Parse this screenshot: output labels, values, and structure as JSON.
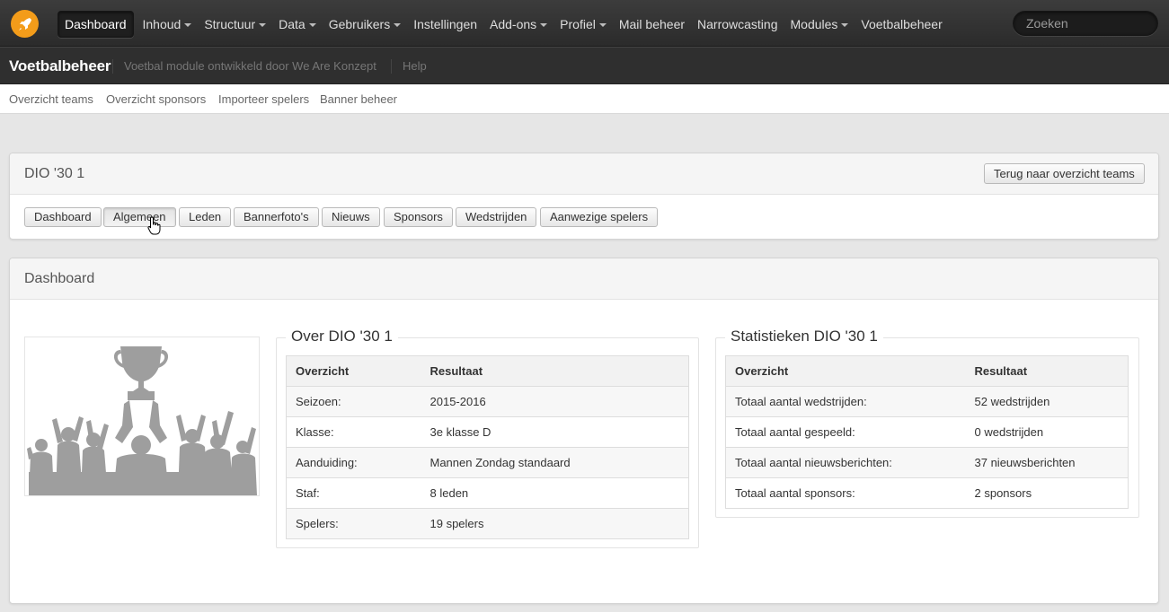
{
  "topnav": {
    "items": [
      {
        "label": "Dashboard",
        "dropdown": false,
        "active": true
      },
      {
        "label": "Inhoud",
        "dropdown": true
      },
      {
        "label": "Structuur",
        "dropdown": true
      },
      {
        "label": "Data",
        "dropdown": true
      },
      {
        "label": "Gebruikers",
        "dropdown": true
      },
      {
        "label": "Instellingen",
        "dropdown": false
      },
      {
        "label": "Add-ons",
        "dropdown": true
      },
      {
        "label": "Profiel",
        "dropdown": true
      },
      {
        "label": "Mail beheer",
        "dropdown": false
      },
      {
        "label": "Narrowcasting",
        "dropdown": false
      },
      {
        "label": "Modules",
        "dropdown": true
      },
      {
        "label": "Voetbalbeheer",
        "dropdown": false
      }
    ],
    "search_placeholder": "Zoeken",
    "logo_icon": "rocket-icon",
    "accent": "#f39c1a"
  },
  "subheader": {
    "brand": "Voetbalbeheer",
    "description": "Voetbal module ontwikkeld door We Are Konzept",
    "help": "Help"
  },
  "thirdnav": [
    "Overzicht teams",
    "Overzicht sponsors",
    "Importeer spelers",
    "Banner beheer"
  ],
  "team_panel": {
    "title": "DIO '30 1",
    "back_button": "Terug naar overzicht teams",
    "tabs": [
      "Dashboard",
      "Algemeen",
      "Leden",
      "Bannerfoto's",
      "Nieuws",
      "Sponsors",
      "Wedstrijden",
      "Aanwezige spelers"
    ]
  },
  "dashboard_panel": {
    "title": "Dashboard",
    "about": {
      "legend": "Over DIO '30 1",
      "headers": [
        "Overzicht",
        "Resultaat"
      ],
      "rows": [
        [
          "Seizoen:",
          "2015-2016"
        ],
        [
          "Klasse:",
          "3e klasse D"
        ],
        [
          "Aanduiding:",
          "Mannen Zondag standaard"
        ],
        [
          "Staf:",
          "8 leden"
        ],
        [
          "Spelers:",
          "19 spelers"
        ]
      ]
    },
    "stats": {
      "legend": "Statistieken DIO '30 1",
      "headers": [
        "Overzicht",
        "Resultaat"
      ],
      "rows": [
        [
          "Totaal aantal wedstrijden:",
          "52 wedstrijden"
        ],
        [
          "Totaal aantal gespeeld:",
          "0 wedstrijden"
        ],
        [
          "Totaal aantal nieuwsberichten:",
          "37 nieuwsberichten"
        ],
        [
          "Totaal aantal sponsors:",
          "2 sponsors"
        ]
      ]
    }
  }
}
